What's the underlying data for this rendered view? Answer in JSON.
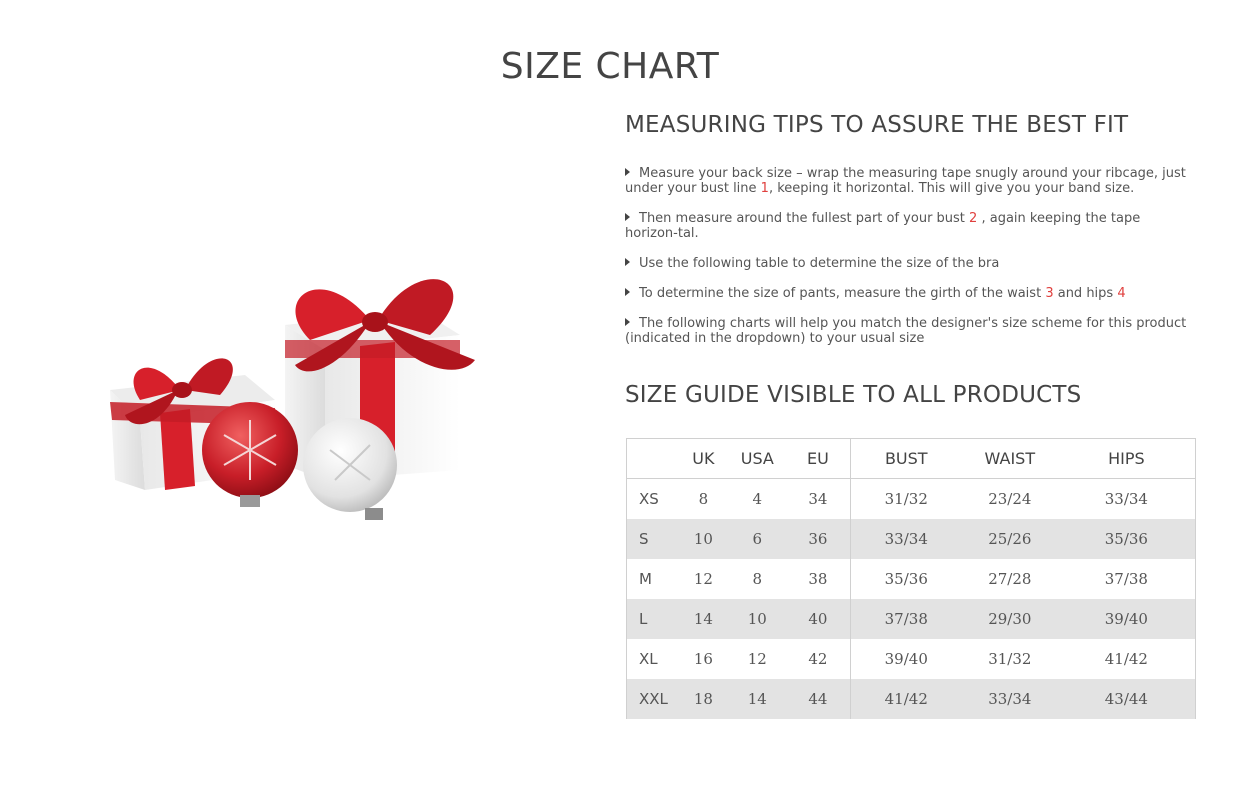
{
  "page": {
    "title": "SIZE CHART"
  },
  "tips_section": {
    "heading": "MEASURING TIPS TO ASSURE THE BEST FIT",
    "tips": [
      {
        "before": "Measure your back size – wrap the measuring tape snugly around your ribcage, just under your bust line ",
        "num": "1",
        "after": ", keeping it horizontal. This will give you your band size."
      },
      {
        "before": "Then measure around the fullest part of your bust ",
        "num": "2",
        "after": " , again keeping the tape horizon-tal."
      },
      {
        "before": "Use the following table to determine the size of the bra",
        "num": "",
        "after": ""
      },
      {
        "before": "To determine the size of pants, measure the girth of the waist ",
        "num": "3",
        "after": " and hips ",
        "num2": "4"
      },
      {
        "before": "The following charts will help you match the designer's size scheme for this product (indicated in the dropdown) to your usual size",
        "num": "",
        "after": ""
      }
    ]
  },
  "guide_section": {
    "heading": "SIZE GUIDE VISIBLE TO ALL PRODUCTS"
  },
  "size_table": {
    "headers": [
      "",
      "UK",
      "USA",
      "EU",
      "BUST",
      "WAIST",
      "HIPS"
    ],
    "rows": [
      [
        "XS",
        "8",
        "4",
        "34",
        "31/32",
        "23/24",
        "33/34"
      ],
      [
        "S",
        "10",
        "6",
        "36",
        "33/34",
        "25/26",
        "35/36"
      ],
      [
        "M",
        "12",
        "8",
        "38",
        "35/36",
        "27/28",
        "37/38"
      ],
      [
        "L",
        "14",
        "10",
        "40",
        "37/38",
        "29/30",
        "39/40"
      ],
      [
        "XL",
        "16",
        "12",
        "42",
        "39/40",
        "31/32",
        "41/42"
      ],
      [
        "XXL",
        "18",
        "14",
        "44",
        "41/42",
        "33/34",
        "43/44"
      ]
    ]
  },
  "colors": {
    "accent_number": "#e0403e",
    "row_shade": "#e3e3e3",
    "ribbon": "#d7202b"
  }
}
